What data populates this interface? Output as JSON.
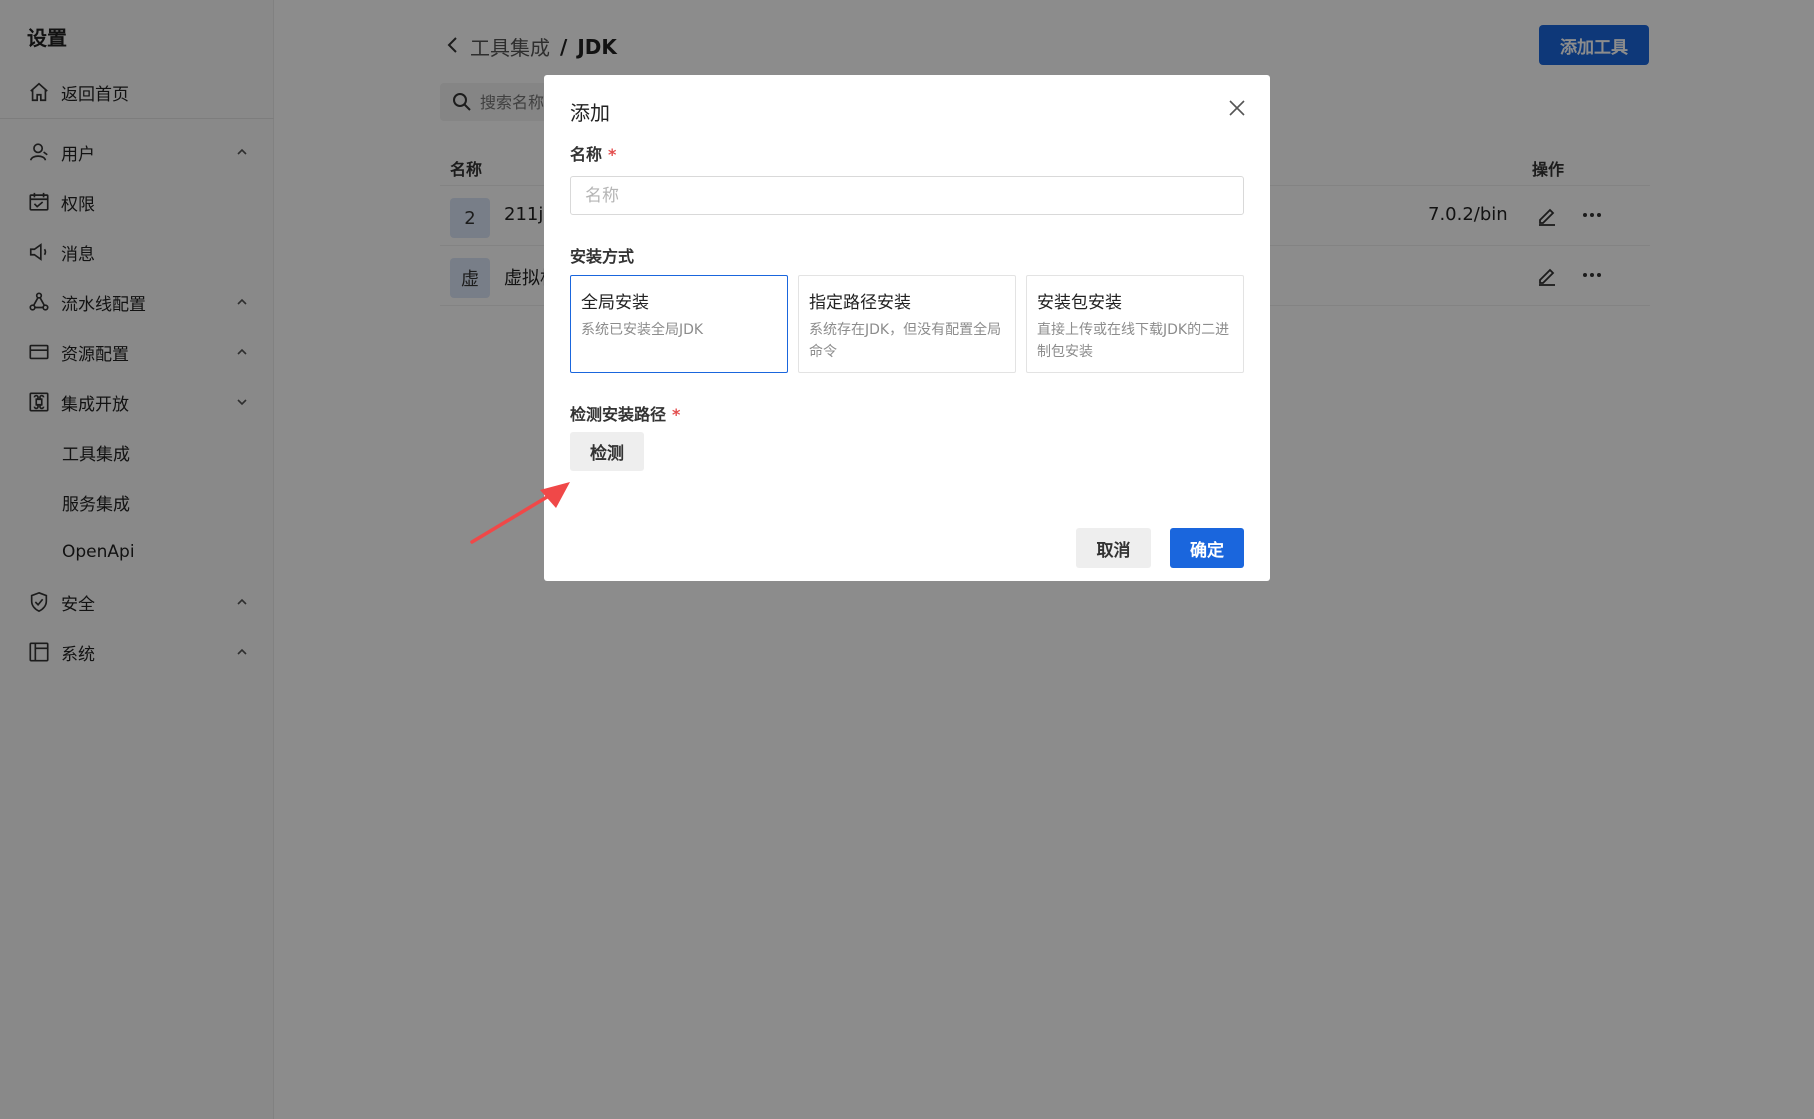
{
  "sidebar": {
    "title": "设置",
    "home": "返回首页",
    "items": [
      {
        "label": "用户",
        "icon": "user-icon"
      },
      {
        "label": "权限",
        "icon": "calendar-icon"
      },
      {
        "label": "消息",
        "icon": "megaphone-icon"
      },
      {
        "label": "流水线配置",
        "icon": "pipeline-icon"
      },
      {
        "label": "资源配置",
        "icon": "card-icon"
      },
      {
        "label": "集成开放",
        "icon": "command-icon"
      }
    ],
    "sub_items": [
      "工具集成",
      "服务集成",
      "OpenApi"
    ],
    "bottom_items": [
      {
        "label": "安全",
        "icon": "shield-icon"
      },
      {
        "label": "系统",
        "icon": "layout-icon"
      }
    ]
  },
  "header": {
    "crumb_parent": "工具集成",
    "crumb_sep": "/",
    "crumb_current": "JDK",
    "add_button": "添加工具"
  },
  "search": {
    "placeholder": "搜索名称"
  },
  "table": {
    "col_name": "名称",
    "col_ops": "操作",
    "rows": [
      {
        "avatar": "2",
        "name": "211jdk",
        "path": "7.0.2/bin"
      },
      {
        "avatar": "虚",
        "name": "虚拟机",
        "path": ""
      }
    ]
  },
  "modal": {
    "title": "添加",
    "name_label": "名称",
    "name_placeholder": "名称",
    "install_label": "安装方式",
    "options": [
      {
        "title": "全局安装",
        "desc": "系统已安装全局JDK",
        "selected": true
      },
      {
        "title": "指定路径安装",
        "desc": "系统存在JDK，但没有配置全局命令",
        "selected": false
      },
      {
        "title": "安装包安装",
        "desc": "直接上传或在线下载JDK的二进制包安装",
        "selected": false
      }
    ],
    "detect_label": "检测安装路径",
    "detect_button": "检测",
    "cancel_button": "取消",
    "confirm_button": "确定"
  },
  "colors": {
    "accent": "#1a66dd",
    "required": "#e34d4d",
    "arrow": "#f04848"
  }
}
